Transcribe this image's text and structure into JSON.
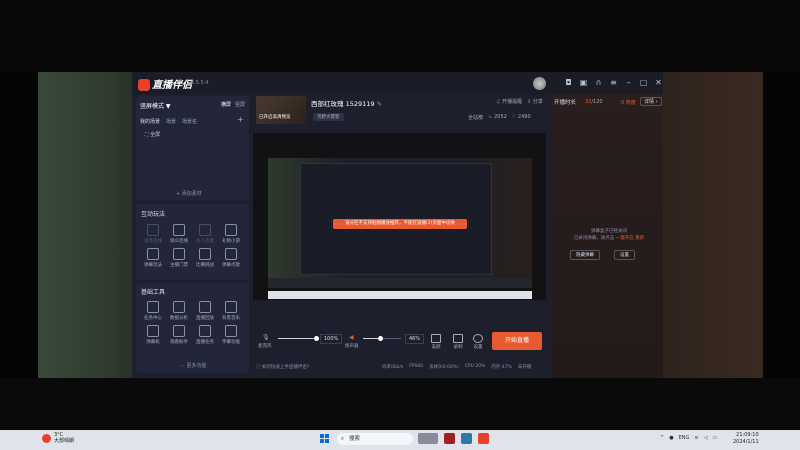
{
  "app": {
    "name": "直播伴侣",
    "version": "6.5.5.4"
  },
  "left": {
    "mode_label": "竖屏模式 ▼",
    "mode_tabs": [
      "横屏",
      "竖屏"
    ],
    "scene_tabs": [
      "我的场景",
      "场景",
      "场景名"
    ],
    "scene_item": "全屏",
    "add_material": "+ 添加素材",
    "interact_title": "互动玩法",
    "interact_tools": [
      {
        "label": "语音连线",
        "dim": true
      },
      {
        "label": "观众连线",
        "dim": false
      },
      {
        "label": "多人连麦",
        "dim": true
      },
      {
        "label": "礼物小游",
        "dim": false
      },
      {
        "label": "弹幕玩法",
        "dim": false
      },
      {
        "label": "主播门票",
        "dim": false
      },
      {
        "label": "比赛挑战",
        "dim": false
      },
      {
        "label": "弹幕点歌",
        "dim": false
      }
    ],
    "basic_title": "基础工具",
    "basic_tools": [
      {
        "label": "任务中心"
      },
      {
        "label": "数据分析"
      },
      {
        "label": "直播回放"
      },
      {
        "label": "背景音乐"
      },
      {
        "label": "弹幕机"
      },
      {
        "label": "观看助手"
      },
      {
        "label": "直播任务"
      },
      {
        "label": "字幕功能"
      }
    ],
    "more": "··· 更多功能"
  },
  "stream": {
    "thumb_label": "已开启高清预览",
    "title": "西部红玫瑰 1529119",
    "tag": "荒野大镖客",
    "head_actions": [
      "开播提醒",
      "分享"
    ],
    "stats": [
      "全站榜",
      "2052",
      "2490"
    ],
    "toast": "该分区不支持贴图播放推荐，不能在竖播(2)页面中切换"
  },
  "controls": {
    "mic_label": "麦克风",
    "mic_pct": "100%",
    "mic_level": 1.0,
    "speaker_label": "扬声器",
    "speaker_pct": "46%",
    "speaker_level": 0.46,
    "beauty_label": "美颜",
    "record_label": "录制",
    "settings_label": "设置",
    "start_label": "开始直播"
  },
  "statusbar": {
    "left": "如何快速上手直播伴侣?",
    "metrics": [
      "码率0kb/s",
      "FPS60",
      "丢帧0(0.00%)",
      "CPU 20%",
      "内存 47%",
      "未开播"
    ]
  },
  "right": {
    "rank_title": "开播时长",
    "rank_count_hl": "32",
    "rank_count_total": "/120",
    "flame": "0 热度",
    "detail": "详情 ›",
    "empty_line1": "弹幕盒子已经关闭",
    "empty_line2": "已关闭弹幕，请点击",
    "empty_link": "一键开启",
    "empty_line3": "重新",
    "buttons": [
      "隐藏弹幕",
      "设置"
    ]
  },
  "taskbar": {
    "temp": "3°C",
    "weather": "大部晴朗",
    "search": "搜索",
    "lang": "ENG",
    "time": "21:09:10",
    "date": "2024/1/11"
  }
}
